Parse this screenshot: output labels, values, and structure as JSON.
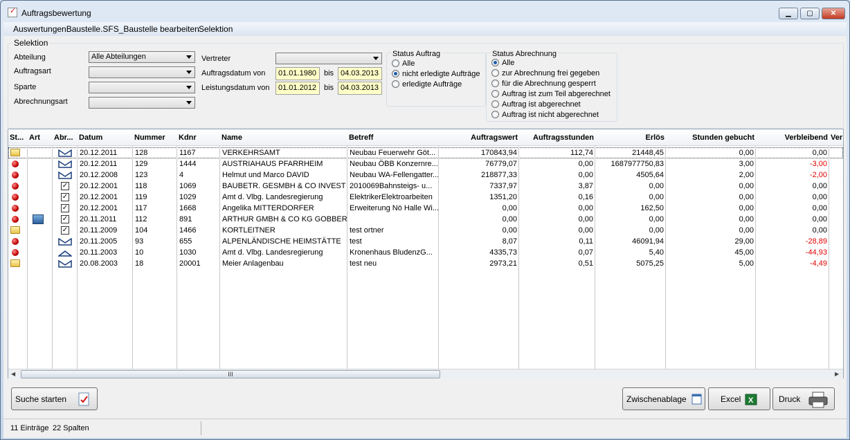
{
  "window": {
    "title": "Auftragsbewertung",
    "min": "▁",
    "max": "▢",
    "close": "✕"
  },
  "menu": [
    "AuswertungenBaustelle.SFS_Baustelle bearbeiten",
    "Selektion"
  ],
  "selection": {
    "caption": "Selektion",
    "abteilung_label": "Abteilung",
    "abteilung_value": "Alle Abteilungen",
    "auftragsart_label": "Auftragsart",
    "auftragsart_value": "",
    "sparte_label": "Sparte",
    "sparte_value": "",
    "abrechnungsart_label": "Abrechnungsart",
    "abrechnungsart_value": "",
    "vertreter_label": "Vertreter",
    "vertreter_value": "",
    "auftragsdatum_label": "Auftragsdatum von",
    "auftragsdatum_from": "01.01.1980",
    "auftragsdatum_to": "04.03.2013",
    "leistungsdatum_label": "Leistungsdatum von",
    "leistungsdatum_from": "01.01.2012",
    "leistungsdatum_to": "04.03.2013",
    "bis": "bis",
    "status_auftrag": {
      "caption": "Status Auftrag",
      "options": [
        "Alle",
        "nicht erledigte Aufträge",
        "erledigte Aufträge"
      ],
      "selected": 1
    },
    "status_abrechnung": {
      "caption": "Status Abrechnung",
      "options": [
        "Alle",
        "zur Abrechnung frei gegeben",
        "für die Abrechnung gesperrt",
        "Auftrag ist zum Teil abgerechnet",
        "Auftrag ist abgerechnet",
        "Auftrag ist nicht abgerechnet"
      ],
      "selected": 0
    }
  },
  "grid": {
    "columns": [
      "St...",
      "Art",
      "Abr...",
      "Datum",
      "Nummer",
      "Kdnr",
      "Name",
      "Betreff",
      "Auftragswert",
      "Auftragsstunden",
      "Erlös",
      "Stunden gebucht",
      "Verbleibend",
      "Ver"
    ],
    "rows": [
      {
        "status": "folder",
        "art": "",
        "abr": "env",
        "datum": "20.12.2011",
        "nummer": "128",
        "kdnr": "1167",
        "name": "VERKEHRSAMT",
        "betreff": "Neubau Feuerwehr Göt...",
        "wert": "170843,94",
        "stunden": "112,74",
        "erloes": "21448,45",
        "gebucht": "0,00",
        "verbl": "0,00",
        "neg": false
      },
      {
        "status": "red",
        "art": "",
        "abr": "env",
        "datum": "20.12.2011",
        "nummer": "129",
        "kdnr": "1444",
        "name": "AUSTRIAHAUS PFARRHEIM",
        "betreff": "Neubau ÖBB Konzernre...",
        "wert": "76779,07",
        "stunden": "0,00",
        "erloes": "1687977750,83",
        "gebucht": "3,00",
        "verbl": "-3,00",
        "neg": true
      },
      {
        "status": "red",
        "art": "",
        "abr": "env",
        "datum": "20.12.2008",
        "nummer": "123",
        "kdnr": "4",
        "name": "Helmut und Marco DAVID",
        "betreff": "Neubau WA-Fellengatter...",
        "wert": "218877,33",
        "stunden": "0,00",
        "erloes": "4505,64",
        "gebucht": "2,00",
        "verbl": "-2,00",
        "neg": true
      },
      {
        "status": "red",
        "art": "",
        "abr": "chk",
        "datum": "20.12.2001",
        "nummer": "118",
        "kdnr": "1069",
        "name": "BAUBETR. GESMBH & CO INVEST",
        "betreff": "2010069Bahnsteigs- u...",
        "wert": "7337,97",
        "stunden": "3,87",
        "erloes": "0,00",
        "gebucht": "0,00",
        "verbl": "0,00",
        "neg": false
      },
      {
        "status": "red",
        "art": "",
        "abr": "chk",
        "datum": "20.12.2001",
        "nummer": "119",
        "kdnr": "1029",
        "name": "Amt d. Vlbg. Landesregierung",
        "betreff": "ElektrikerElektroarbeiten",
        "wert": "1351,20",
        "stunden": "0,16",
        "erloes": "0,00",
        "gebucht": "0,00",
        "verbl": "0,00",
        "neg": false
      },
      {
        "status": "red",
        "art": "",
        "abr": "chk",
        "datum": "20.12.2001",
        "nummer": "117",
        "kdnr": "1668",
        "name": "Angelika MITTERDORFER",
        "betreff": "Erweiterung Nö Halle Wi...",
        "wert": "0,00",
        "stunden": "0,00",
        "erloes": "162,50",
        "gebucht": "0,00",
        "verbl": "0,00",
        "neg": false
      },
      {
        "status": "red",
        "art": "tool",
        "abr": "chk",
        "datum": "20.11.2011",
        "nummer": "112",
        "kdnr": "891",
        "name": "ARTHUR GMBH & CO KG GOBBER",
        "betreff": "",
        "wert": "0,00",
        "stunden": "0,00",
        "erloes": "0,00",
        "gebucht": "0,00",
        "verbl": "0,00",
        "neg": false
      },
      {
        "status": "folder",
        "art": "",
        "abr": "chk",
        "datum": "20.11.2009",
        "nummer": "104",
        "kdnr": "1466",
        "name": "KORTLEITNER",
        "betreff": "test ortner",
        "wert": "0,00",
        "stunden": "0,00",
        "erloes": "0,00",
        "gebucht": "0,00",
        "verbl": "0,00",
        "neg": false
      },
      {
        "status": "red",
        "art": "",
        "abr": "env",
        "datum": "20.11.2005",
        "nummer": "93",
        "kdnr": "655",
        "name": "ALPENLÄNDISCHE HEIMSTÄTTE",
        "betreff": "test",
        "wert": "8,07",
        "stunden": "0,11",
        "erloes": "46091,94",
        "gebucht": "29,00",
        "verbl": "-28,89",
        "neg": true
      },
      {
        "status": "red",
        "art": "",
        "abr": "env2",
        "datum": "20.11.2003",
        "nummer": "10",
        "kdnr": "1030",
        "name": "Amt d. Vlbg. Landesregierung",
        "betreff": "Kronenhaus BludenzG...",
        "wert": "4335,73",
        "stunden": "0,07",
        "erloes": "5,40",
        "gebucht": "45,00",
        "verbl": "-44,93",
        "neg": true
      },
      {
        "status": "folder",
        "art": "",
        "abr": "env",
        "datum": "20.08.2003",
        "nummer": "18",
        "kdnr": "20001",
        "name": "Meier Anlagenbau",
        "betreff": "test neu",
        "wert": "2973,21",
        "stunden": "0,51",
        "erloes": "5075,25",
        "gebucht": "5,00",
        "verbl": "-4,49",
        "neg": true
      }
    ]
  },
  "buttons": {
    "suche": "Suche starten",
    "zwischenablage": "Zwischenablage",
    "excel": "Excel",
    "druck": "Druck"
  },
  "status": {
    "eintraege": "11 Einträge",
    "spalten": "22 Spalten"
  },
  "scroll_grip": "III"
}
